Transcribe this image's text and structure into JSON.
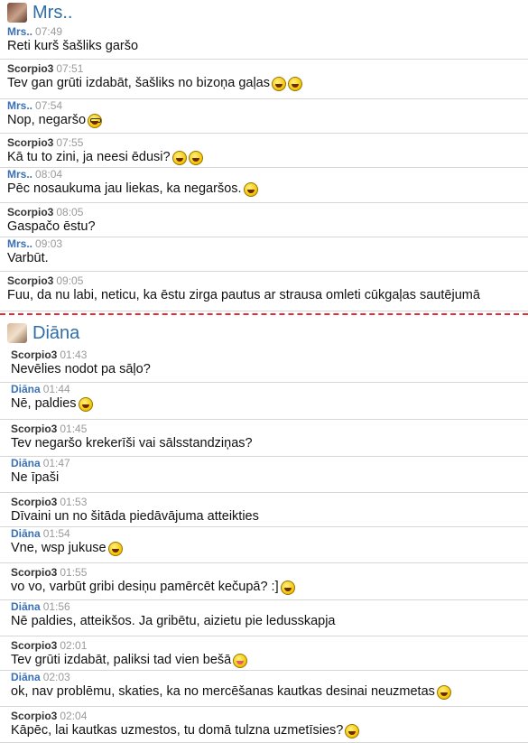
{
  "chat1": {
    "title": "Mrs..",
    "messages": [
      {
        "sender": "Mrs..",
        "type": "mrs",
        "time": "07:49",
        "text": "Reti kurš šašliks garšo",
        "emoji": []
      },
      {
        "sender": "Scorpio3",
        "type": "scorpio",
        "time": "07:51",
        "text": "Tev gan grūti izdabāt, šašliks no bizoņa gaļas",
        "emoji": [
          "laugh",
          "laugh"
        ]
      },
      {
        "sender": "Mrs..",
        "type": "mrs",
        "time": "07:54",
        "text": "Nop, negaršo",
        "emoji": [
          "nerd"
        ]
      },
      {
        "sender": "Scorpio3",
        "type": "scorpio",
        "time": "07:55",
        "text": "Kā tu to zini, ja neesi ēdusi?",
        "emoji": [
          "laugh",
          "laugh"
        ]
      },
      {
        "sender": "Mrs..",
        "type": "mrs",
        "time": "08:04",
        "text": "Pēc nosaukuma jau liekas, ka negaršos.",
        "emoji": [
          "laugh"
        ]
      },
      {
        "sender": "Scorpio3",
        "type": "scorpio",
        "time": "08:05",
        "text": "Gaspačo ēstu?",
        "emoji": []
      },
      {
        "sender": "Mrs..",
        "type": "mrs",
        "time": "09:03",
        "text": "Varbūt.",
        "emoji": []
      },
      {
        "sender": "Scorpio3",
        "type": "scorpio",
        "time": "09:05",
        "text": "Fuu, da nu labi, neticu, ka ēstu zirga pautus ar strausa omleti cūkgaļas sautējumā",
        "emoji": []
      }
    ]
  },
  "chat2": {
    "title": "Diāna",
    "messages": [
      {
        "sender": "Scorpio3",
        "type": "scorpio",
        "time": "01:43",
        "text": "Nevēlies nodot pa sāļo?",
        "emoji": []
      },
      {
        "sender": "Diāna",
        "type": "mrs",
        "time": "01:44",
        "text": "Nē, paldies",
        "emoji": [
          "laugh"
        ]
      },
      {
        "sender": "Scorpio3",
        "type": "scorpio",
        "time": "01:45",
        "text": "Tev negaršo krekerīši vai sālsstandziņas?",
        "emoji": []
      },
      {
        "sender": "Diāna",
        "type": "mrs",
        "time": "01:47",
        "text": "Ne īpaši",
        "emoji": []
      },
      {
        "sender": "Scorpio3",
        "type": "scorpio",
        "time": "01:53",
        "text": "Dīvaini un no šitāda piedāvājuma atteikties",
        "emoji": []
      },
      {
        "sender": "Diāna",
        "type": "mrs",
        "time": "01:54",
        "text": "Vne, wsp jukuse",
        "emoji": [
          "laugh"
        ]
      },
      {
        "sender": "Scorpio3",
        "type": "scorpio",
        "time": "01:55",
        "text": "vo vo, varbūt gribi desiņu pamērcēt kečupā? :]",
        "emoji": [
          "laugh"
        ]
      },
      {
        "sender": "Diāna",
        "type": "mrs",
        "time": "01:56",
        "text": "Nē paldies, atteikšos. Ja gribētu, aizietu pie ledusskapja",
        "emoji": []
      },
      {
        "sender": "Scorpio3",
        "type": "scorpio",
        "time": "02:01",
        "text": "Tev grūti izdabāt, paliksi tad vien bešā",
        "emoji": [
          "tongue"
        ]
      },
      {
        "sender": "Diāna",
        "type": "mrs",
        "time": "02:03",
        "text": "ok, nav problēmu, skaties, ka no mercēšanas kautkas desinai neuzmetas",
        "emoji": [
          "laugh"
        ]
      },
      {
        "sender": "Scorpio3",
        "type": "scorpio",
        "time": "02:04",
        "text": "Kāpēc, lai kautkas uzmestos, tu domā tulzna uzmetīsies?",
        "emoji": [
          "laugh"
        ]
      }
    ]
  }
}
